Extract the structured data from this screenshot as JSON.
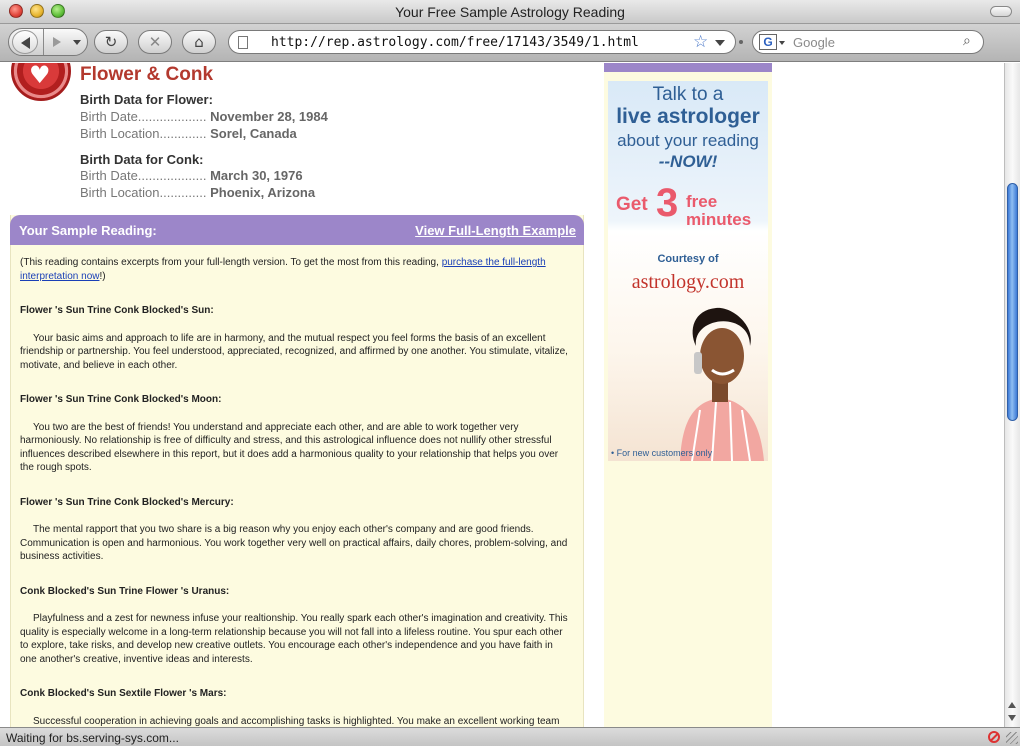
{
  "window": {
    "title": "Your Free Sample Astrology Reading"
  },
  "toolbar": {
    "url": "http://rep.astrology.com/free/17143/3549/1.html",
    "search_placeholder": "Google",
    "search_engine_glyph": "G"
  },
  "page": {
    "title": "Flower & Conk",
    "person1": {
      "heading": "Birth Data for Flower:",
      "date_label": "Birth Date...................",
      "date_value": "November 28, 1984",
      "loc_label": "Birth Location.............",
      "loc_value": "Sorel, Canada"
    },
    "person2": {
      "heading": "Birth Data for Conk:",
      "date_label": "Birth Date...................",
      "date_value": "March 30, 1976",
      "loc_label": "Birth Location.............",
      "loc_value": "Phoenix, Arizona"
    },
    "reading": {
      "header_title": "Your Sample Reading:",
      "header_link": "View Full-Length Example",
      "intro_before": "(This reading contains excerpts from your full-length version. To get the most from this reading, ",
      "intro_link": "purchase the full-length interpretation now",
      "intro_after": "!)",
      "sections": [
        {
          "title": "Flower 's Sun Trine Conk Blocked's Sun:",
          "text": "Your basic aims and approach to life are in harmony, and the mutual respect you feel forms the basis of an excellent friendship or partnership. You feel understood, appreciated, recognized, and affirmed by one another. You stimulate, vitalize, motivate, and believe in each other."
        },
        {
          "title": "Flower 's Sun Trine Conk Blocked's Moon:",
          "text": "You two are the best of friends! You understand and appreciate each other, and are able to work together very harmoniously. No relationship is free of difficulty and stress, and this astrological influence does not nullify other stressful influences described elsewhere in this report, but it does add a harmonious quality to your relationship that helps you over the rough spots."
        },
        {
          "title": "Flower 's Sun Trine Conk Blocked's Mercury:",
          "text": "The mental rapport that you two share is a big reason why you enjoy each other's company and are good friends. Communication is open and harmonious. You work together very well on practical affairs, daily chores, problem-solving, and business activities."
        },
        {
          "title": "Conk Blocked's Sun Trine Flower 's Uranus:",
          "text": "Playfulness and a zest for newness infuse your realtionship. You really spark each other's imagination and creativity. This quality is especially welcome in a long-term relationship because you will not fall into a lifeless routine. You spur each other to explore, take risks, and develop new creative outlets. You encourage each other's independence and you have faith in one another's creative, inventive ideas and interests."
        },
        {
          "title": "Conk Blocked's Sun Sextile Flower 's Mars:",
          "text": "Successful cooperation in achieving goals and accomplishing tasks is highlighted. You make an excellent working team and you are able to assist each other in achieving specific, concrete goals."
        }
      ]
    },
    "ad": {
      "line1": "Talk to a",
      "line2": "live astrologer",
      "line3": "about your reading",
      "line4": "--NOW!",
      "get": "Get",
      "three": "3",
      "free": "free",
      "minutes": "minutes",
      "courtesy": "Courtesy of",
      "brand": "astrology.com",
      "note": "• For new customers only"
    }
  },
  "status": {
    "text": "Waiting for bs.serving-sys.com..."
  },
  "colors": {
    "title_red": "#b3392e",
    "header_purple": "#9c86c9",
    "reading_bg": "#fdfbe0",
    "link_blue": "#1a3fb6",
    "ad_blue": "#2f5f95",
    "ad_pink": "#ea5a6c"
  }
}
